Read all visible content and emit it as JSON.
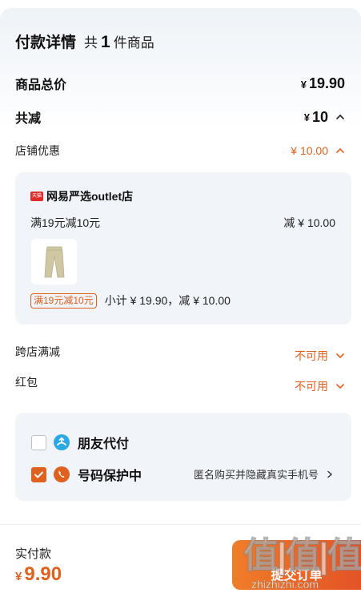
{
  "header": {
    "title": "付款详情",
    "gong": "共",
    "count": "1",
    "unit": "件商品"
  },
  "summary": {
    "goods_total_label": "商品总价",
    "goods_total_yen": "¥",
    "goods_total_value": "19.90",
    "reduction_label": "共减",
    "reduction_yen": "¥",
    "reduction_value": "10",
    "store_discount_label": "店铺优惠",
    "store_discount_value": "¥ 10.00"
  },
  "store_card": {
    "badge": "天猫",
    "store_name": "网易严选outlet店",
    "promo_text": "满19元减10元",
    "promo_reduce": "减 ¥ 10.00",
    "tag": "满19元减10元",
    "subtotal": "小计 ¥ 19.90，减 ¥ 10.00"
  },
  "cross_store": {
    "label": "跨店满减",
    "value": "不可用"
  },
  "red_packet": {
    "label": "红包",
    "value": "不可用"
  },
  "pay_options": {
    "friend_pay_label": "朋友代付",
    "friend_pay_checked": false,
    "number_protect_label": "号码保护中",
    "number_protect_checked": true,
    "number_protect_desc": "匿名购买并隐藏真实手机号"
  },
  "footer": {
    "amount_label": "实付款",
    "amount_yen": "¥",
    "amount_value": "9.90",
    "submit_label": "提交订单"
  },
  "watermark": {
    "glyphs": "值|值|值",
    "url": "zhizhizhi.com"
  },
  "colors": {
    "accent": "#e0601d",
    "card_bg": "#f1f4f8"
  }
}
